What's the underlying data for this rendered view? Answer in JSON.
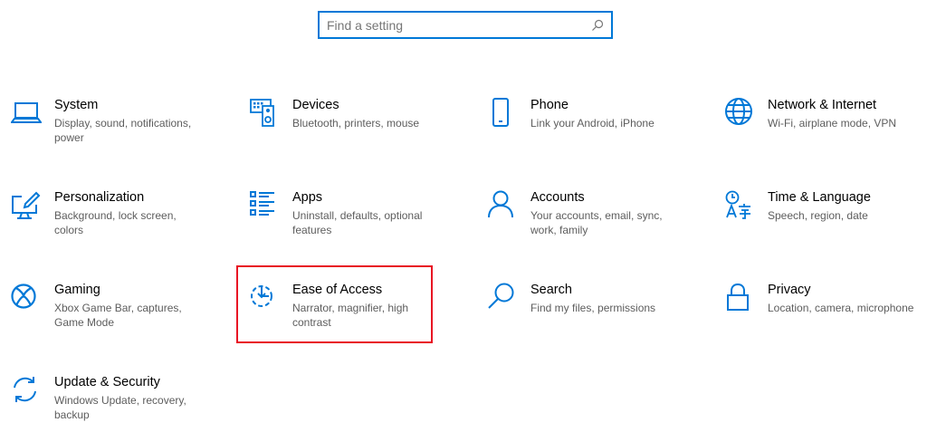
{
  "search": {
    "placeholder": "Find a setting",
    "value": ""
  },
  "accent_color": "#0078d7",
  "highlight_color": "#e81123",
  "tiles": [
    {
      "icon": "laptop-icon",
      "title": "System",
      "desc": "Display, sound, notifications, power"
    },
    {
      "icon": "devices-icon",
      "title": "Devices",
      "desc": "Bluetooth, printers, mouse"
    },
    {
      "icon": "phone-icon",
      "title": "Phone",
      "desc": "Link your Android, iPhone"
    },
    {
      "icon": "globe-icon",
      "title": "Network & Internet",
      "desc": "Wi-Fi, airplane mode, VPN"
    },
    {
      "icon": "paint-brush-icon",
      "title": "Personalization",
      "desc": "Background, lock screen, colors"
    },
    {
      "icon": "apps-list-icon",
      "title": "Apps",
      "desc": "Uninstall, defaults, optional features"
    },
    {
      "icon": "person-icon",
      "title": "Accounts",
      "desc": "Your accounts, email, sync, work, family"
    },
    {
      "icon": "time-language-icon",
      "title": "Time & Language",
      "desc": "Speech, region, date"
    },
    {
      "icon": "xbox-icon",
      "title": "Gaming",
      "desc": "Xbox Game Bar, captures, Game Mode"
    },
    {
      "icon": "ease-of-access-icon",
      "title": "Ease of Access",
      "desc": "Narrator, magnifier, high contrast",
      "highlighted": true
    },
    {
      "icon": "search-icon",
      "title": "Search",
      "desc": "Find my files, permissions"
    },
    {
      "icon": "lock-icon",
      "title": "Privacy",
      "desc": "Location, camera, microphone"
    },
    {
      "icon": "sync-icon",
      "title": "Update & Security",
      "desc": "Windows Update, recovery, backup"
    }
  ]
}
